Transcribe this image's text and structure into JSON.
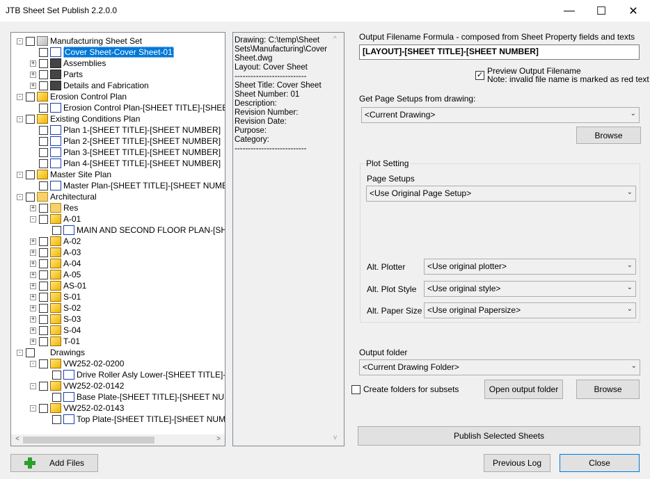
{
  "window": {
    "title": "JTB Sheet Set Publish 2.2.0.0"
  },
  "tree": {
    "items": [
      {
        "level": 0,
        "expander": "-",
        "icon": "set",
        "label": "Manufacturing Sheet Set"
      },
      {
        "level": 1,
        "expander": "",
        "icon": "sheet",
        "label": "Cover Sheet-Cover Sheet-01",
        "selected": true
      },
      {
        "level": 1,
        "expander": "+",
        "icon": "dark",
        "label": "Assemblies"
      },
      {
        "level": 1,
        "expander": "+",
        "icon": "dark",
        "label": "Parts"
      },
      {
        "level": 1,
        "expander": "+",
        "icon": "dark",
        "label": "Details and Fabrication"
      },
      {
        "level": 0,
        "expander": "-",
        "icon": "sub",
        "label": "Erosion Control Plan"
      },
      {
        "level": 1,
        "expander": "",
        "icon": "sheet",
        "label": "Erosion Control Plan-[SHEET TITLE]-[SHEET NUMBER]"
      },
      {
        "level": 0,
        "expander": "-",
        "icon": "sub",
        "label": "Existing Conditions Plan"
      },
      {
        "level": 1,
        "expander": "",
        "icon": "sheet",
        "label": "Plan 1-[SHEET TITLE]-[SHEET NUMBER]"
      },
      {
        "level": 1,
        "expander": "",
        "icon": "sheet",
        "label": "Plan 2-[SHEET TITLE]-[SHEET NUMBER]"
      },
      {
        "level": 1,
        "expander": "",
        "icon": "sheet",
        "label": "Plan 3-[SHEET TITLE]-[SHEET NUMBER]"
      },
      {
        "level": 1,
        "expander": "",
        "icon": "sheet",
        "label": "Plan 4-[SHEET TITLE]-[SHEET NUMBER]"
      },
      {
        "level": 0,
        "expander": "-",
        "icon": "sub",
        "label": "Master Site Plan"
      },
      {
        "level": 1,
        "expander": "",
        "icon": "sheet",
        "label": "Master Plan-[SHEET TITLE]-[SHEET NUMBER]"
      },
      {
        "level": 0,
        "expander": "-",
        "icon": "folder",
        "label": "Architectural"
      },
      {
        "level": 1,
        "expander": "+",
        "icon": "folder",
        "label": "Res"
      },
      {
        "level": 1,
        "expander": "-",
        "icon": "sub",
        "label": "A-01"
      },
      {
        "level": 2,
        "expander": "",
        "icon": "sheet",
        "label": "MAIN AND SECOND FLOOR PLAN-[SHEET TITLE]"
      },
      {
        "level": 1,
        "expander": "+",
        "icon": "sub",
        "label": "A-02"
      },
      {
        "level": 1,
        "expander": "+",
        "icon": "sub",
        "label": "A-03"
      },
      {
        "level": 1,
        "expander": "+",
        "icon": "sub",
        "label": "A-04"
      },
      {
        "level": 1,
        "expander": "+",
        "icon": "sub",
        "label": "A-05"
      },
      {
        "level": 1,
        "expander": "+",
        "icon": "sub",
        "label": "AS-01"
      },
      {
        "level": 1,
        "expander": "+",
        "icon": "sub",
        "label": "S-01"
      },
      {
        "level": 1,
        "expander": "+",
        "icon": "sub",
        "label": "S-02"
      },
      {
        "level": 1,
        "expander": "+",
        "icon": "sub",
        "label": "S-03"
      },
      {
        "level": 1,
        "expander": "+",
        "icon": "sub",
        "label": "S-04"
      },
      {
        "level": 1,
        "expander": "+",
        "icon": "sub",
        "label": "T-01"
      },
      {
        "level": 0,
        "expander": "-",
        "icon": "dsd",
        "label": "Drawings"
      },
      {
        "level": 1,
        "expander": "-",
        "icon": "sub",
        "label": "VW252-02-0200"
      },
      {
        "level": 2,
        "expander": "",
        "icon": "sheet",
        "label": "Drive Roller Asly Lower-[SHEET TITLE]-[SHEET NUMBER]"
      },
      {
        "level": 1,
        "expander": "-",
        "icon": "sub",
        "label": "VW252-02-0142"
      },
      {
        "level": 2,
        "expander": "",
        "icon": "sheet",
        "label": "Base Plate-[SHEET TITLE]-[SHEET NUMBER]"
      },
      {
        "level": 1,
        "expander": "-",
        "icon": "sub",
        "label": "VW252-02-0143"
      },
      {
        "level": 2,
        "expander": "",
        "icon": "sheet",
        "label": "Top Plate-[SHEET TITLE]-[SHEET NUMBER]"
      }
    ]
  },
  "info_panel": {
    "text": "Drawing: C:\\temp\\Sheet Sets\\Manufacturing\\Cover Sheet.dwg\nLayout: Cover Sheet\n---------------------------\nSheet Title: Cover Sheet\nSheet Number: 01\nDescription:\nRevision Number:\nRevision Date:\nPurpose:\nCategory:\n---------------------------"
  },
  "output_formula": {
    "label": "Output Filename Formula - composed from Sheet Property fields and texts",
    "value": "[LAYOUT]-[SHEET TITLE]-[SHEET NUMBER]"
  },
  "preview": {
    "checked_mark": "✓",
    "label": "Preview Output Filename",
    "note": "Note: invalid file name is marked as red text"
  },
  "page_setups_source": {
    "label": "Get Page Setups from drawing:",
    "value": "<Current Drawing>",
    "browse_label": "Browse"
  },
  "plot_setting": {
    "title": "Plot Setting",
    "page_setups_label": "Page Setups",
    "page_setups_value": "<Use Original Page Setup>",
    "alt_plotter_label": "Alt. Plotter",
    "alt_plotter_value": "<Use original plotter>",
    "alt_plot_style_label": "Alt. Plot Style",
    "alt_plot_style_value": "<Use original style>",
    "alt_paper_size_label": "Alt. Paper Size",
    "alt_paper_size_value": "<Use original Papersize>"
  },
  "output_folder": {
    "label": "Output folder",
    "value": "<Current Drawing Folder>",
    "create_subfolders_label": "Create folders for subsets",
    "open_label": "Open output folder",
    "browse_label": "Browse"
  },
  "actions": {
    "publish_label": "Publish Selected Sheets",
    "add_files_label": "Add Files",
    "previous_log_label": "Previous Log",
    "close_label": "Close"
  },
  "icons": {
    "minimize": "—",
    "maximize": "☐",
    "close": "✕",
    "dropdown": "⌄",
    "scroll_left": "<",
    "scroll_right": ">",
    "scroll_up": "^",
    "scroll_down": "v"
  }
}
